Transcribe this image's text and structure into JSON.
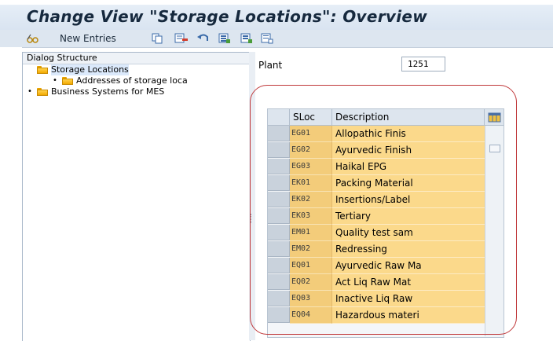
{
  "window": {
    "title": "Change View \"Storage Locations\": Overview"
  },
  "toolbar": {
    "new_entries_label": "New Entries",
    "icons": [
      "glasses-icon",
      "copy-icon",
      "delete-icon",
      "undo-icon",
      "select-all-icon",
      "select-block-icon",
      "deselect-all-icon"
    ]
  },
  "dialog_structure": {
    "header": "Dialog Structure",
    "items": [
      {
        "label": "Storage Locations",
        "expanded": true,
        "selected": true
      },
      {
        "label": "Addresses of storage loca",
        "child": true
      },
      {
        "label": "Business Systems for MES"
      }
    ]
  },
  "plant": {
    "label": "Plant",
    "value": "1251"
  },
  "table": {
    "columns": [
      "SLoc",
      "Description"
    ],
    "rows": [
      {
        "sloc": "EG01",
        "description": "Allopathic Finis"
      },
      {
        "sloc": "EG02",
        "description": "Ayurvedic Finish"
      },
      {
        "sloc": "EG03",
        "description": "Haikal EPG"
      },
      {
        "sloc": "EK01",
        "description": "Packing Material"
      },
      {
        "sloc": "EK02",
        "description": "Insertions/Label"
      },
      {
        "sloc": "EK03",
        "description": "Tertiary"
      },
      {
        "sloc": "EM01",
        "description": "Quality test sam"
      },
      {
        "sloc": "EM02",
        "description": "Redressing"
      },
      {
        "sloc": "EQ01",
        "description": "Ayurvedic Raw Ma"
      },
      {
        "sloc": "EQ02",
        "description": "Act Liq Raw Mat"
      },
      {
        "sloc": "EQ03",
        "description": "Inactive Liq Raw"
      },
      {
        "sloc": "EQ04",
        "description": "Hazardous materi"
      }
    ]
  },
  "colors": {
    "title_bar": "#dfe8f3",
    "sloc_cell": "#f3cc7a",
    "desc_cell": "#fbd98b",
    "highlight_oval": "#c0393b"
  }
}
